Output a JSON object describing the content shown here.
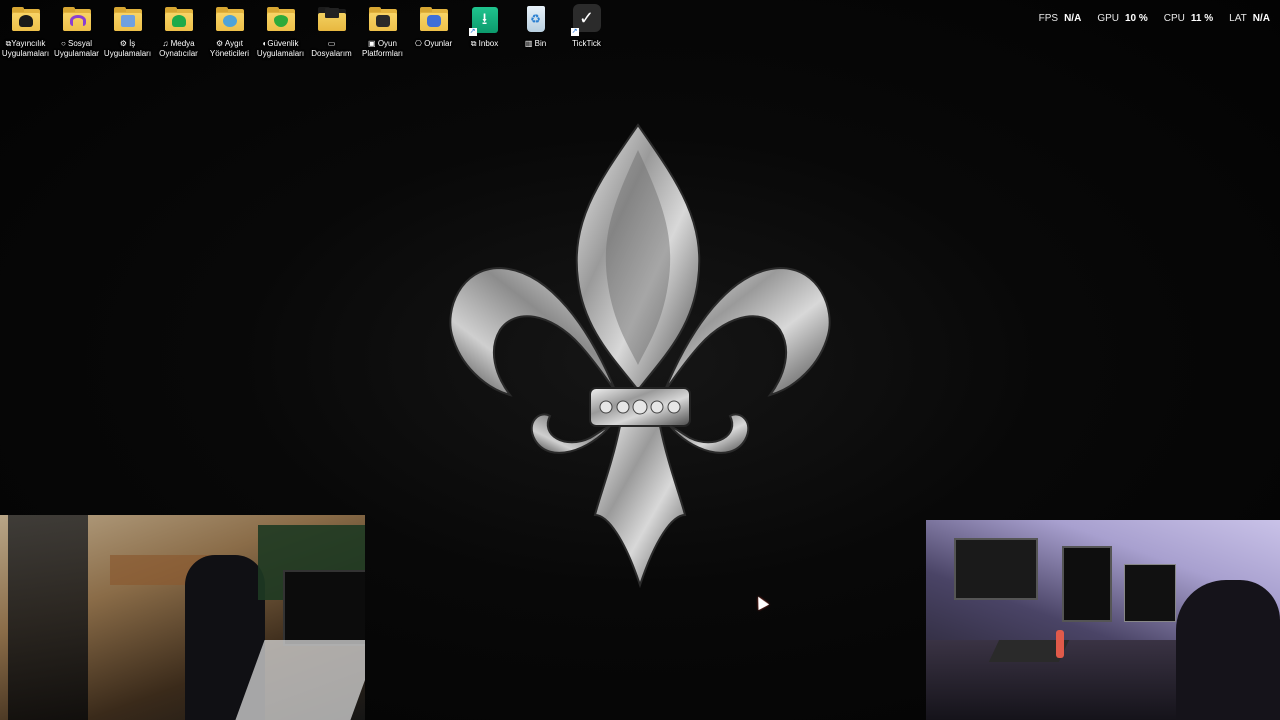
{
  "desktop_icons": [
    {
      "label": "⧉Yayıncılık\nUygulamaları",
      "icon": "folder-streaming-icon",
      "emblem_color": "#1a1a1a"
    },
    {
      "label": "○ Sosyal\nUygulamalar",
      "icon": "folder-social-icon",
      "emblem_color": "#8a3fd1"
    },
    {
      "label": "⚙ İş\nUygulamaları",
      "icon": "folder-work-icon",
      "emblem_color": "#3f7fd1"
    },
    {
      "label": "♫ Medya\nOynatıcılar",
      "icon": "folder-media-icon",
      "emblem_color": "#1faa4a"
    },
    {
      "label": "⚙ Aygıt\nYöneticileri",
      "icon": "folder-device-icon",
      "emblem_color": "#4fa3d8"
    },
    {
      "label": "◐Güvenlik\nUygulamaları",
      "icon": "folder-security-icon",
      "emblem_color": "#2eaa3a"
    },
    {
      "label": "▭\nDosyalarım",
      "icon": "folder-files-icon",
      "emblem_color": "#222222"
    },
    {
      "label": "▣ Oyun\nPlatformları",
      "icon": "folder-game-platforms-icon",
      "emblem_color": "#2a2a2a"
    },
    {
      "label": "⎔ Oyunlar",
      "icon": "folder-games-icon",
      "emblem_color": "#3f6fd8"
    },
    {
      "label": "⧉ Inbox",
      "icon": "inbox-app-icon",
      "emblem_color": "#18b383"
    },
    {
      "label": "▥ Bin",
      "icon": "recycle-bin-icon",
      "emblem_color": "#2a7fd1"
    },
    {
      "label": "TickTick",
      "icon": "ticktick-app-icon",
      "emblem_color": "#2b2b2b"
    }
  ],
  "performance_overlay": {
    "fps_label": "FPS",
    "fps_value": "N/A",
    "gpu_label": "GPU",
    "gpu_value": "10 %",
    "cpu_label": "CPU",
    "cpu_value": "11 %",
    "lat_label": "LAT",
    "lat_value": "N/A"
  },
  "wallpaper": {
    "emblem": "fleur-de-lis-icon",
    "color": "#c8c8c8"
  },
  "webcams": [
    {
      "name": "room-camera-left",
      "tone": "warm"
    },
    {
      "name": "desk-camera-right",
      "tone": "purple"
    }
  ]
}
